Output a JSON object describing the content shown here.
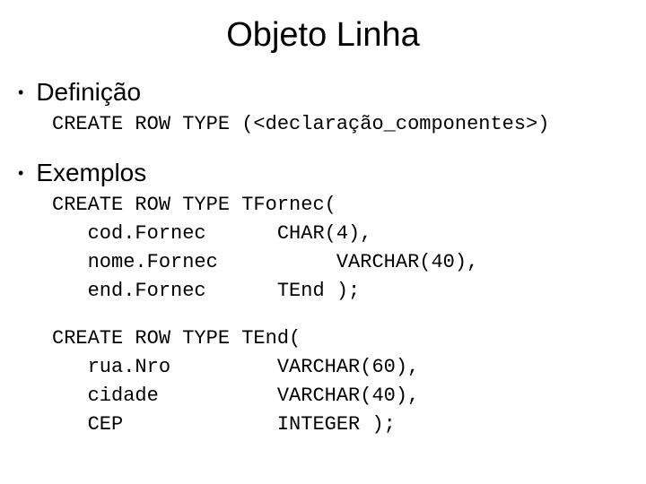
{
  "title": "Objeto Linha",
  "sections": {
    "definicao": {
      "heading": "Definição",
      "code": "CREATE ROW TYPE (<declaração_componentes>)"
    },
    "exemplos": {
      "heading": "Exemplos",
      "code1": "CREATE ROW TYPE TFornec(\n   cod.Fornec      CHAR(4),\n   nome.Fornec          VARCHAR(40),\n   end.Fornec      TEnd );",
      "code2": "CREATE ROW TYPE TEnd(\n   rua.Nro         VARCHAR(60),\n   cidade          VARCHAR(40),\n   CEP             INTEGER );"
    }
  }
}
